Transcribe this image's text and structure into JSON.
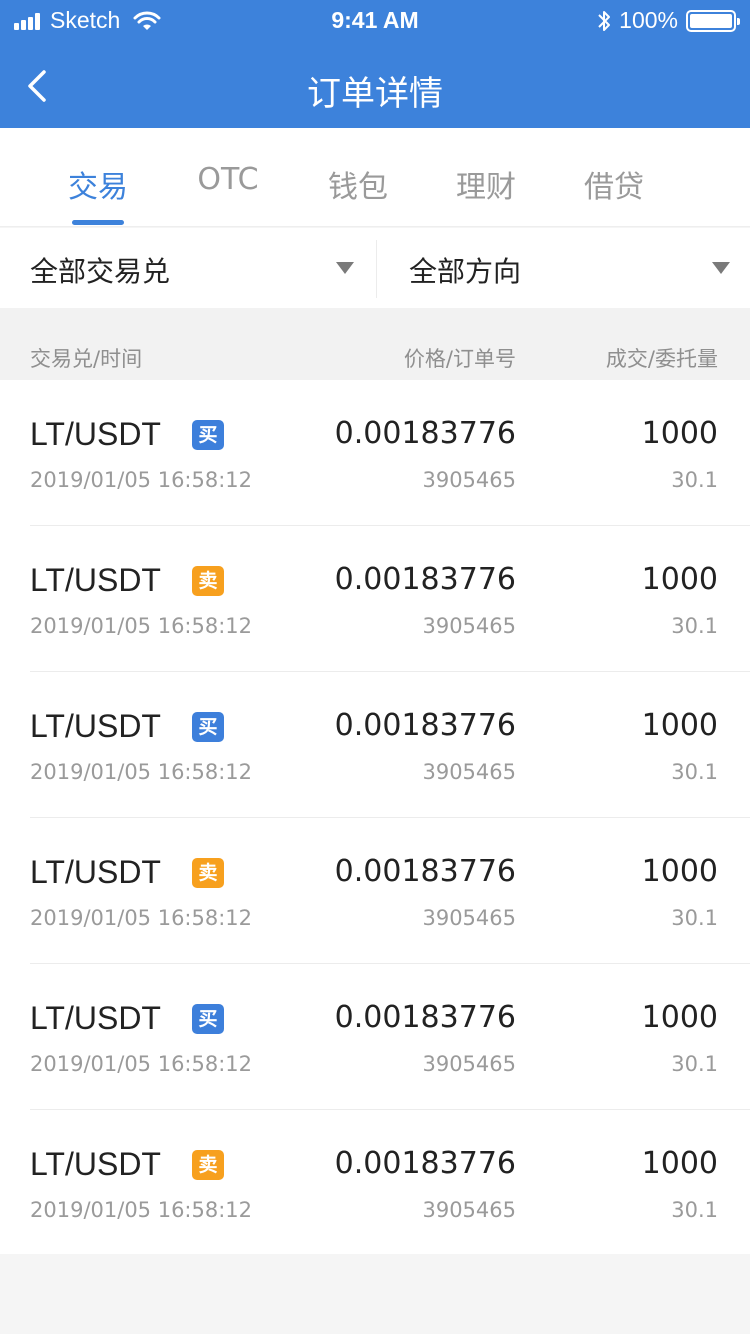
{
  "status_bar": {
    "carrier": "Sketch",
    "time": "9:41 AM",
    "battery": "100%"
  },
  "nav": {
    "title": "订单详情"
  },
  "tabs": [
    {
      "label": "交易",
      "active": true
    },
    {
      "label": "OTC",
      "active": false
    },
    {
      "label": "钱包",
      "active": false
    },
    {
      "label": "理财",
      "active": false
    },
    {
      "label": "借贷",
      "active": false
    }
  ],
  "filters": {
    "pair": "全部交易兑",
    "direction": "全部方向"
  },
  "columns": {
    "pair_time": "交易兑/时间",
    "price_order": "价格/订单号",
    "fill_entrust": "成交/委托量"
  },
  "colors": {
    "primary": "#3d82db",
    "buy": "#3d7fdb",
    "sell": "#f7a01e"
  },
  "orders": [
    {
      "pair": "LT/USDT",
      "side": "买",
      "side_type": "buy",
      "time": "2019/01/05 16:58:12",
      "price": "0.00183776",
      "order_no": "3905465",
      "filled": "1000",
      "entrusted": "30.1"
    },
    {
      "pair": "LT/USDT",
      "side": "卖",
      "side_type": "sell",
      "time": "2019/01/05 16:58:12",
      "price": "0.00183776",
      "order_no": "3905465",
      "filled": "1000",
      "entrusted": "30.1"
    },
    {
      "pair": "LT/USDT",
      "side": "买",
      "side_type": "buy",
      "time": "2019/01/05 16:58:12",
      "price": "0.00183776",
      "order_no": "3905465",
      "filled": "1000",
      "entrusted": "30.1"
    },
    {
      "pair": "LT/USDT",
      "side": "卖",
      "side_type": "sell",
      "time": "2019/01/05 16:58:12",
      "price": "0.00183776",
      "order_no": "3905465",
      "filled": "1000",
      "entrusted": "30.1"
    },
    {
      "pair": "LT/USDT",
      "side": "买",
      "side_type": "buy",
      "time": "2019/01/05 16:58:12",
      "price": "0.00183776",
      "order_no": "3905465",
      "filled": "1000",
      "entrusted": "30.1"
    },
    {
      "pair": "LT/USDT",
      "side": "卖",
      "side_type": "sell",
      "time": "2019/01/05 16:58:12",
      "price": "0.00183776",
      "order_no": "3905465",
      "filled": "1000",
      "entrusted": "30.1"
    }
  ]
}
